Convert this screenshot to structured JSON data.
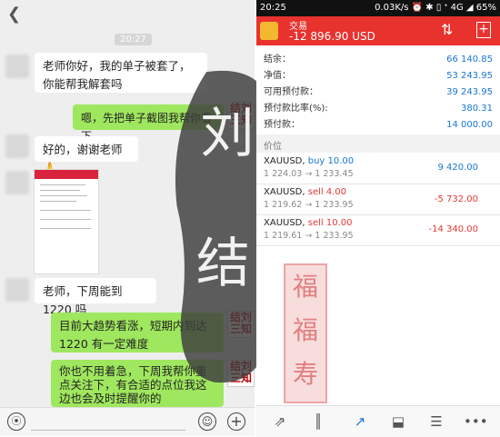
{
  "chat": {
    "time_badge": "20:27",
    "messages": [
      {
        "side": "left",
        "text": "老师你好，我的单子被套了，你能帮我解套吗"
      },
      {
        "side": "right",
        "text": "嗯，先把单子截图我帮你看下"
      },
      {
        "side": "left",
        "text": "好的，谢谢老师🙏"
      },
      {
        "side": "left",
        "text": "老师，下周能到1220 吗"
      },
      {
        "side": "right",
        "text": "目前大趋势看涨，短期内到达 1220 有一定难度"
      },
      {
        "side": "right",
        "text": "你也不用着急，下周我帮你重点关注下，有合适的点位我这边也会及时提醒你的"
      }
    ],
    "sender_avatar_text": "结刘\n三知"
  },
  "watermark": {
    "text1": "刘",
    "text2": "结",
    "seal_text": "福\n福\n寿"
  },
  "status_bar": {
    "time": "20:25",
    "right": "0.03K/s ⏰ ✱ ▯ ᐩ 4G ◢ 65%"
  },
  "header": {
    "title": "交易",
    "balance": "-12 896.90 USD"
  },
  "account": [
    {
      "label": "结余：",
      "value": "66 140.85"
    },
    {
      "label": "净值：",
      "value": "53 243.95"
    },
    {
      "label": "可用预付款：",
      "value": "39 243.95"
    },
    {
      "label": "预付款比率(%):",
      "value": "380.31"
    },
    {
      "label": "预付款：",
      "value": "14 000.00"
    }
  ],
  "positions_header": "价位",
  "positions": [
    {
      "symbol": "XAUUSD,",
      "side": "buy 10.00",
      "prices": "1 224.03 → 1 233.45",
      "pnl": "9 420.00",
      "side_color": "blue"
    },
    {
      "symbol": "XAUUSD,",
      "side": "sell 4.00",
      "prices": "1 219.62 → 1 233.95",
      "pnl": "-5 732.00",
      "side_color": "red"
    },
    {
      "symbol": "XAUUSD,",
      "side": "sell 10.00",
      "prices": "1 219.61 → 1 233.95",
      "pnl": "-14 340.00",
      "side_color": "red"
    }
  ],
  "colors": {
    "accent_red": "#e8322e",
    "accent_blue": "#1976d2",
    "bubble_green": "#9fe75e"
  },
  "icons": [
    "back-icon",
    "voice-icon",
    "emoji-icon",
    "plus-icon",
    "sort-icon",
    "add-order-icon",
    "quotes-icon",
    "chart-icon",
    "trade-icon",
    "history-icon",
    "news-icon",
    "chat-icon"
  ]
}
